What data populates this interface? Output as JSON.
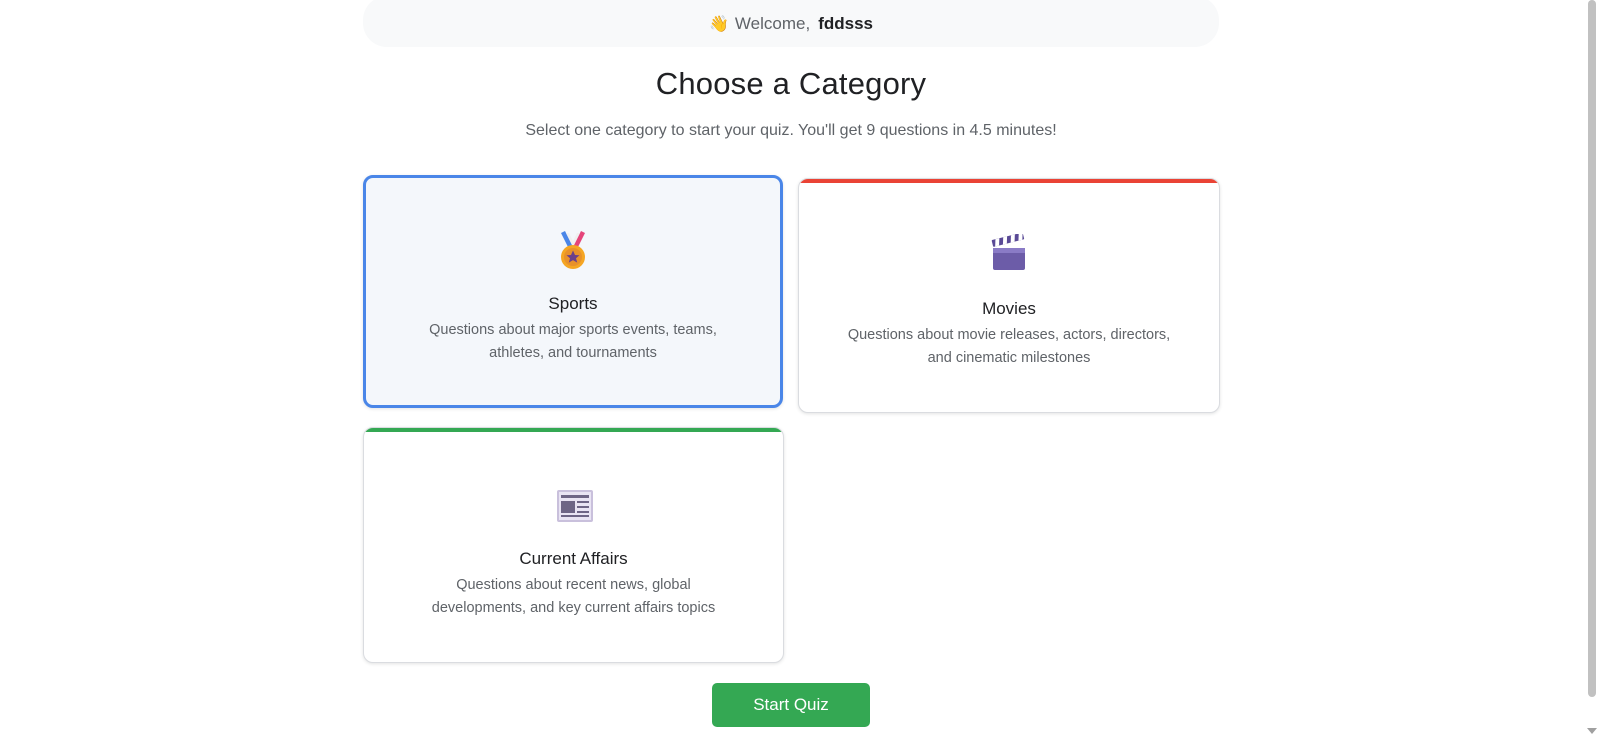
{
  "header": {
    "wave_emoji": "👋",
    "welcome_text": "Welcome,",
    "username": "fddsss"
  },
  "main": {
    "title": "Choose a Category",
    "subtitle": "Select one category to start your quiz. You'll get 9 questions in 4.5 minutes!"
  },
  "categories": [
    {
      "title": "Sports",
      "description": "Questions about major sports events, teams, athletes, and tournaments",
      "icon": "medal-icon",
      "selected": true,
      "accent_color": "#4a86e8"
    },
    {
      "title": "Movies",
      "description": "Questions about movie releases, actors, directors, and cinematic milestones",
      "icon": "clapperboard-icon",
      "selected": false,
      "accent_color": "#ea4335"
    },
    {
      "title": "Current Affairs",
      "description": "Questions about recent news, global developments, and key current affairs topics",
      "icon": "newspaper-icon",
      "selected": false,
      "accent_color": "#34a853"
    }
  ],
  "actions": {
    "start_label": "Start Quiz",
    "start_color": "#34a853"
  }
}
